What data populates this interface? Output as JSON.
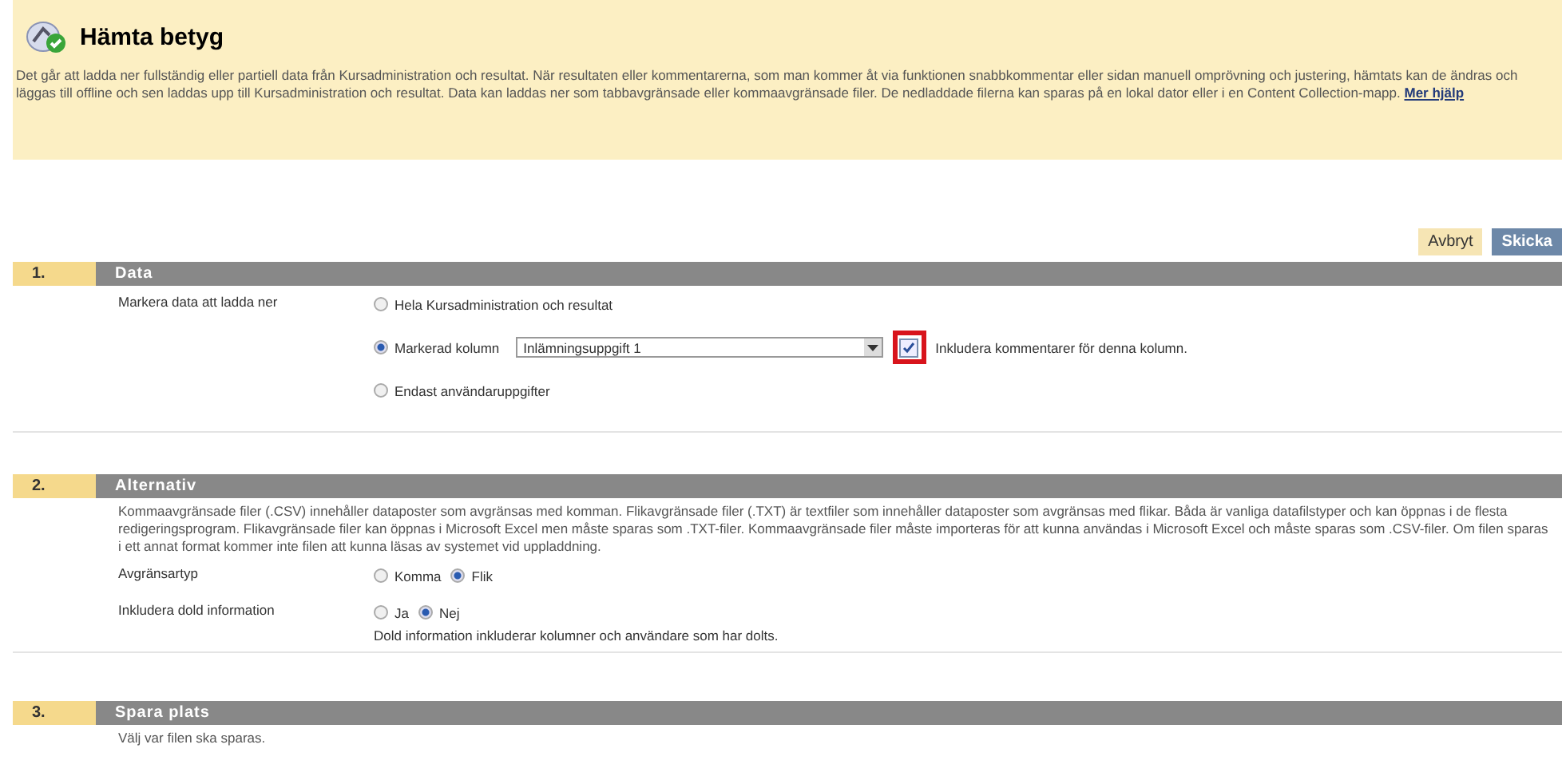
{
  "header": {
    "title": "Hämta betyg",
    "description": "Det går att ladda ner fullständig eller partiell data från Kursadministration och resultat. När resultaten eller kommentarerna, som man kommer åt via funktionen snabbkommentar eller sidan manuell omprövning och justering, hämtats kan de ändras och läggas till offline och sen laddas upp till Kursadministration och resultat. Data kan laddas ner som tabbavgränsade eller kommaavgränsade filer. De nedladdade filerna kan sparas på en lokal dator eller i en Content Collection-mapp.",
    "help_link": "Mer hjälp"
  },
  "buttons": [
    {
      "label": "Avbryt",
      "kind": "cancel"
    },
    {
      "label": "Skicka",
      "kind": "submit"
    }
  ],
  "sections": [
    {
      "number": "1.",
      "title": "Data",
      "fields": [
        {
          "label": "Markera data att ladda ner",
          "options": [
            {
              "label": "Hela Kursadministration och resultat",
              "selected": false
            },
            {
              "label": "Markerad kolumn",
              "selected": true,
              "select": {
                "value": "Inlämningsuppgift 1"
              },
              "checkbox": {
                "label": "Inkludera kommentarer för denna kolumn.",
                "checked": true,
                "highlighted": true
              }
            },
            {
              "label": "Endast användaruppgifter",
              "selected": false
            }
          ]
        }
      ]
    },
    {
      "number": "2.",
      "title": "Alternativ",
      "description": "Kommaavgränsade filer (.CSV) innehåller dataposter som avgränsas med komman. Flikavgränsade filer (.TXT) är textfiler som innehåller dataposter som avgränsas med flikar. Båda är vanliga datafilstyper och kan öppnas i de flesta redigeringsprogram. Flikavgränsade filer kan öppnas i Microsoft Excel men måste sparas som .TXT-filer. Kommaavgränsade filer måste importeras för att kunna användas i Microsoft Excel och måste sparas som .CSV-filer. Om filen sparas i ett annat format kommer inte filen att kunna läsas av systemet vid uppladdning.",
      "fields": [
        {
          "label": "Avgränsartyp",
          "options": [
            {
              "label": "Komma",
              "selected": false
            },
            {
              "label": "Flik",
              "selected": true
            }
          ]
        },
        {
          "label": "Inkludera dold information",
          "options": [
            {
              "label": "Ja",
              "selected": false
            },
            {
              "label": "Nej",
              "selected": true
            }
          ],
          "hint": "Dold information inkluderar kolumner och användare som har dolts."
        }
      ]
    },
    {
      "number": "3.",
      "title": "Spara plats",
      "description": "Välj var filen ska sparas."
    }
  ]
}
